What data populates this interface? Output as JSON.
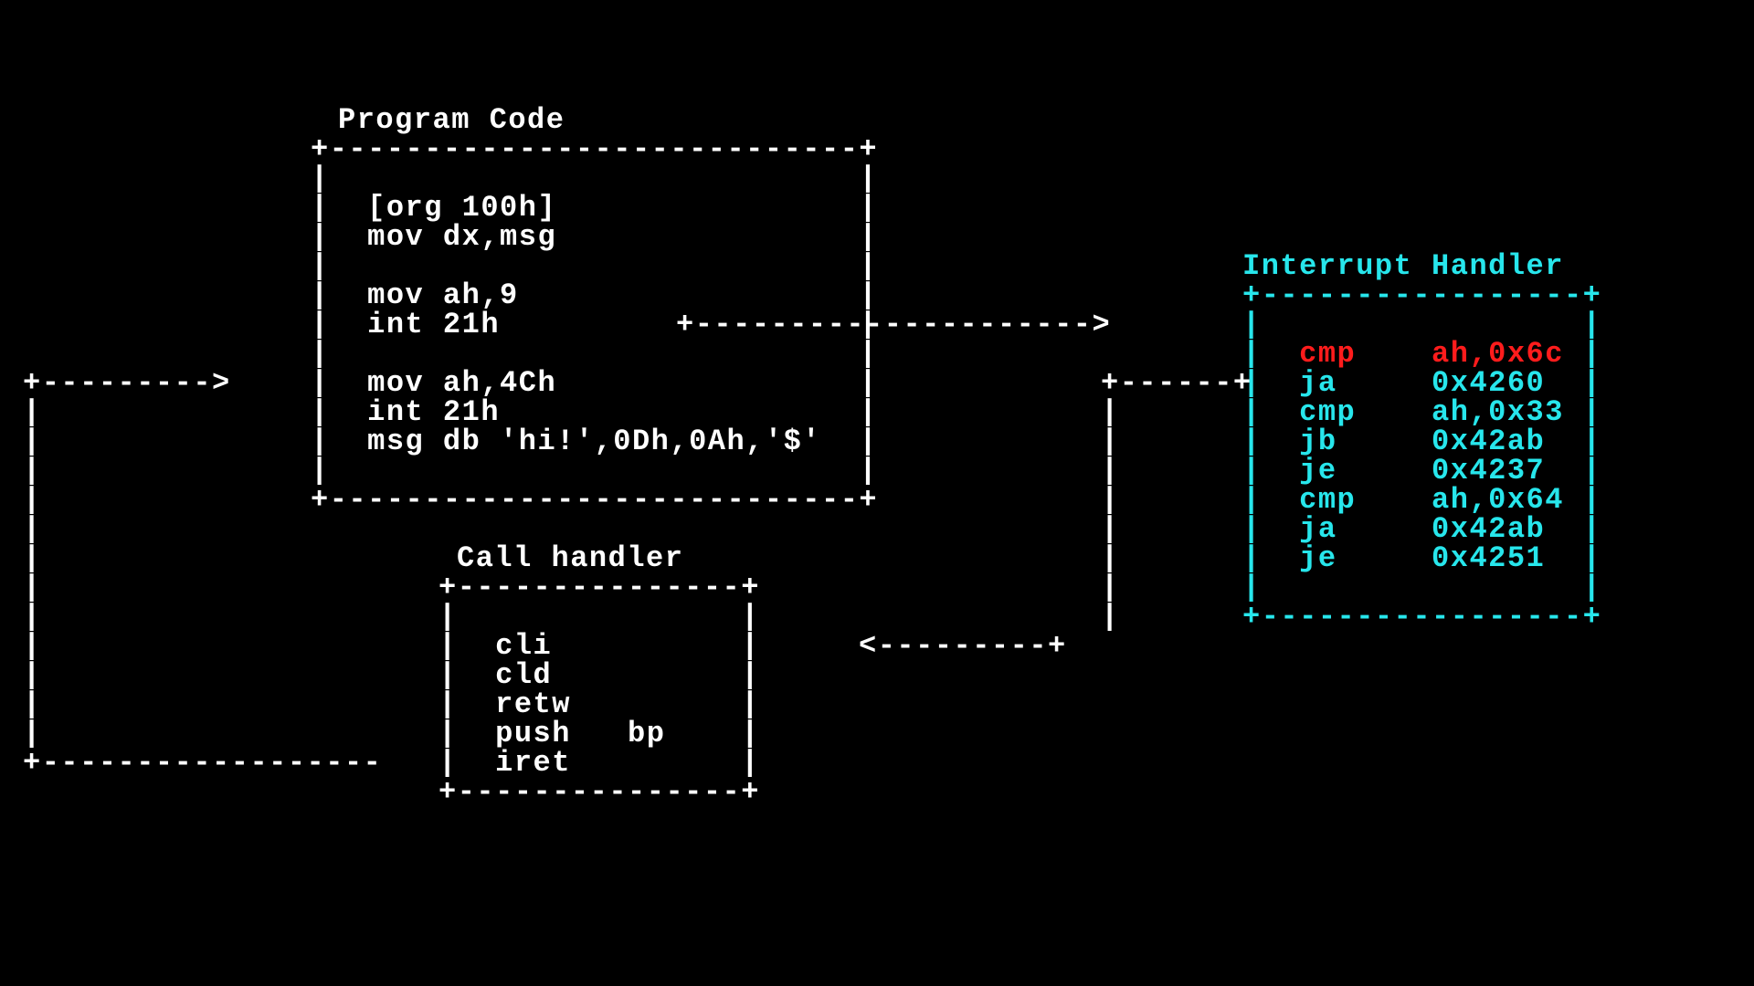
{
  "sections": {
    "program": {
      "title": "Program Code",
      "lines": [
        "[org 100h]",
        "mov dx,msg",
        "",
        "mov ah,9",
        "int 21h",
        "",
        "mov ah,4Ch",
        "int 21h",
        "msg db 'hi!',0Dh,0Ah,'$'"
      ]
    },
    "call": {
      "title": "Call handler",
      "lines": [
        "cli",
        "cld",
        "retw",
        "push   bp",
        "iret"
      ]
    },
    "interrupt": {
      "title": "Interrupt Handler",
      "rows": [
        {
          "mnemonic": "cmp",
          "operands": "ah,0x6c",
          "color": "red"
        },
        {
          "mnemonic": "ja",
          "operands": "0x4260",
          "color": "cyan"
        },
        {
          "mnemonic": "cmp",
          "operands": "ah,0x33",
          "color": "cyan"
        },
        {
          "mnemonic": "jb",
          "operands": "0x42ab",
          "color": "cyan"
        },
        {
          "mnemonic": "je",
          "operands": "0x4237",
          "color": "cyan"
        },
        {
          "mnemonic": "cmp",
          "operands": "ah,0x64",
          "color": "cyan"
        },
        {
          "mnemonic": "ja",
          "operands": "0x42ab",
          "color": "cyan"
        },
        {
          "mnemonic": "je",
          "operands": "0x4251",
          "color": "cyan"
        }
      ]
    }
  },
  "box_art": {
    "program_top": "+----------------------------+",
    "program_side": "|                            |",
    "program_bottom": "+----------------------------+",
    "call_top": "+---------------+",
    "call_side": "|               |",
    "call_bottom": "+---------------+",
    "int_top": "+-----------------+",
    "int_side_l": "|",
    "int_side_r": "|",
    "int_bottom": "+-----------------+",
    "arrow_prog_to_int": "+--------------------->",
    "arrow_call_to_prog_top": "+--------->",
    "arrow_int_to_call_top": "+------+",
    "arrow_int_to_call_mid": "<---------+",
    "arrow_call_to_prog_bot": "+------------------",
    "vbar": "|"
  }
}
